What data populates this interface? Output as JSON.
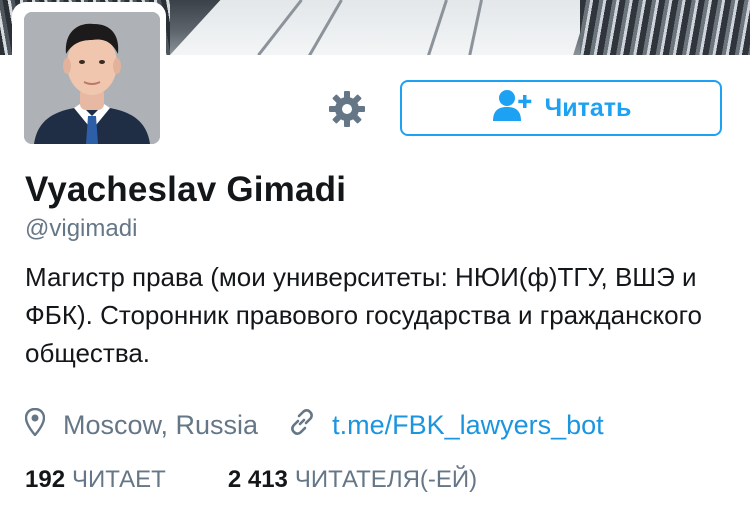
{
  "profile": {
    "name": "Vyacheslav Gimadi",
    "handle": "@vigimadi",
    "bio": "Магистр права (мои университеты: НЮИ(ф)ТГУ, ВШЭ и ФБК). Сторонник правового государства и гражданского общества.",
    "location": "Moscow, Russia",
    "website": "t.me/FBK_lawyers_bot"
  },
  "actions": {
    "follow_label": "Читать",
    "settings_icon": "gear-icon",
    "follow_icon": "add-user-icon"
  },
  "stats": {
    "following_count": "192",
    "following_label": "ЧИТАЕТ",
    "followers_count": "2 413",
    "followers_label": "ЧИТАТЕЛЯ(-ЕЙ)"
  },
  "colors": {
    "accent": "#1da1f2",
    "link": "#1b95e0",
    "muted": "#657786",
    "text": "#14171a"
  }
}
